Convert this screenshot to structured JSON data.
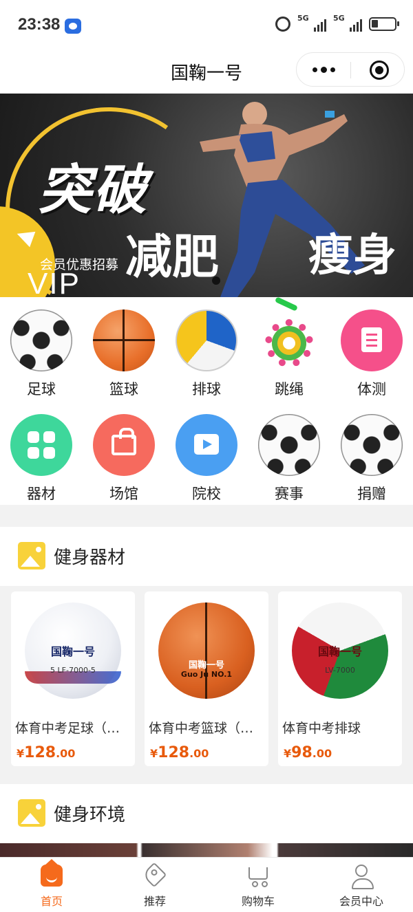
{
  "status_bar": {
    "time": "23:38",
    "network_1": "5G",
    "network_2": "5G",
    "icons": [
      "baidu-icon",
      "alarm-icon",
      "signal-icon",
      "signal-icon",
      "battery-icon"
    ]
  },
  "header": {
    "title": "国鞠一号",
    "more_icon": "more-dots-icon",
    "close_icon": "close-target-icon"
  },
  "banner": {
    "headline": "突破",
    "sub_left": "减肥",
    "sub_right": "瘦身",
    "member_text": "会员优惠招募",
    "vip": "VIP",
    "slide_index": 1,
    "accent_color": "#f3c526"
  },
  "categories": [
    {
      "label": "足球",
      "icon": "soccer-ball-icon"
    },
    {
      "label": "篮球",
      "icon": "basketball-icon"
    },
    {
      "label": "排球",
      "icon": "volleyball-icon"
    },
    {
      "label": "跳绳",
      "icon": "jump-rope-icon"
    },
    {
      "label": "体测",
      "icon": "document-icon"
    },
    {
      "label": "器材",
      "icon": "grid-icon"
    },
    {
      "label": "场馆",
      "icon": "bag-icon"
    },
    {
      "label": "院校",
      "icon": "play-icon"
    },
    {
      "label": "赛事",
      "icon": "soccer-ball-icon"
    },
    {
      "label": "捐赠",
      "icon": "soccer-ball-icon"
    }
  ],
  "section_equipment": {
    "title": "健身器材",
    "icon": "image-icon"
  },
  "products": [
    {
      "name": "体育中考足球（…",
      "currency": "¥",
      "price_int": "128",
      "price_dec": ".00",
      "ball_print": "国鞠一号",
      "ball_model": "5  LF-7000-5"
    },
    {
      "name": "体育中考篮球（…",
      "currency": "¥",
      "price_int": "128",
      "price_dec": ".00",
      "ball_print": "国鞠一号",
      "ball_model": "Guo Ju NO.1"
    },
    {
      "name": "体育中考排球",
      "currency": "¥",
      "price_int": "98",
      "price_dec": ".00",
      "ball_print": "国鞠一号",
      "ball_model": "LV-7000"
    }
  ],
  "section_environment": {
    "title": "健身环境",
    "icon": "image-icon"
  },
  "tab_bar": {
    "active_color": "#f56a1c",
    "tabs": [
      {
        "label": "首页",
        "icon": "home-icon",
        "active": true
      },
      {
        "label": "推荐",
        "icon": "tag-icon",
        "active": false
      },
      {
        "label": "购物车",
        "icon": "cart-icon",
        "active": false
      },
      {
        "label": "会员中心",
        "icon": "user-icon",
        "active": false
      }
    ]
  }
}
